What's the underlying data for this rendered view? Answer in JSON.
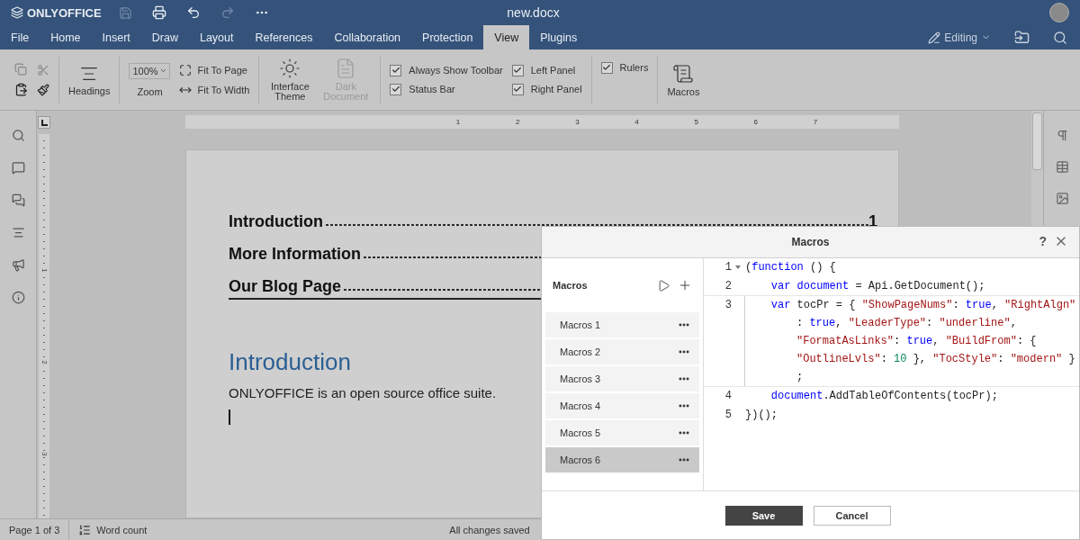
{
  "app": {
    "logo": "ONLYOFFICE",
    "file_name": "new.docx",
    "mode": "Editing"
  },
  "tabs": [
    {
      "label": "File",
      "selected": false
    },
    {
      "label": "Home",
      "selected": false
    },
    {
      "label": "Insert",
      "selected": false
    },
    {
      "label": "Draw",
      "selected": false
    },
    {
      "label": "Layout",
      "selected": false
    },
    {
      "label": "References",
      "selected": false
    },
    {
      "label": "Collaboration",
      "selected": false
    },
    {
      "label": "Protection",
      "selected": false
    },
    {
      "label": "View",
      "selected": true
    },
    {
      "label": "Plugins",
      "selected": false
    }
  ],
  "toolbar": {
    "headings": "Headings",
    "zoom_value": "100%",
    "zoom_label": "Zoom",
    "fit_page": "Fit To Page",
    "fit_width": "Fit To Width",
    "theme": "Interface Theme",
    "dark_document": {
      "label": "Dark Document",
      "disabled": true
    },
    "macros": "Macros",
    "checkboxes": [
      {
        "label": "Always Show Toolbar",
        "checked": true
      },
      {
        "label": "Status Bar",
        "checked": true
      },
      {
        "label": "Left Panel",
        "checked": true
      },
      {
        "label": "Right Panel",
        "checked": true
      },
      {
        "label": "Rulers",
        "checked": true
      }
    ]
  },
  "ruler": {
    "marks": [
      "1",
      "2",
      "3",
      "4",
      "5",
      "6",
      "7"
    ],
    "vertical_marks": [
      "1",
      "2",
      "3"
    ]
  },
  "document": {
    "toc": [
      {
        "title": "Introduction",
        "page": "1"
      },
      {
        "title": "More Information"
      },
      {
        "title": "Our Blog Page"
      }
    ],
    "heading": "Introduction",
    "body": "ONLYOFFICE is an open source office suite."
  },
  "status_bar": {
    "page": "Page 1 of 3",
    "word_count": "Word count",
    "save_status": "All changes saved"
  },
  "dialog": {
    "title": "Macros",
    "help": "?",
    "list_title": "Macros",
    "macros": [
      {
        "name": "Macros 1",
        "selected": false
      },
      {
        "name": "Macros 2",
        "selected": false
      },
      {
        "name": "Macros 3",
        "selected": false
      },
      {
        "name": "Macros 4",
        "selected": false
      },
      {
        "name": "Macros 5",
        "selected": false
      },
      {
        "name": "Macros 6",
        "selected": true
      }
    ],
    "code": [
      {
        "number": "1",
        "foldable": true,
        "active": false,
        "rows": [
          {
            "tokens": [
              {
                "kind": "plain",
                "text": "("
              },
              {
                "kind": "keyword",
                "text": "function"
              },
              {
                "kind": "plain",
                "text": " () {"
              }
            ]
          }
        ]
      },
      {
        "number": "2",
        "foldable": false,
        "active": false,
        "rows": [
          {
            "indented": true,
            "tokens": [
              {
                "kind": "keyword",
                "text": "var document"
              },
              {
                "kind": "plain",
                "text": " = Api.GetDocument();"
              }
            ]
          }
        ]
      },
      {
        "number": "3",
        "foldable": false,
        "active": true,
        "rows": [
          {
            "indented": true,
            "tokens": [
              {
                "kind": "keyword",
                "text": "var"
              },
              {
                "kind": "plain",
                "text": " tocPr = { "
              },
              {
                "kind": "string",
                "text": "\"ShowPageNums\""
              },
              {
                "kind": "plain",
                "text": ": "
              },
              {
                "kind": "keyword",
                "text": "true"
              },
              {
                "kind": "plain",
                "text": ", "
              },
              {
                "kind": "string",
                "text": "\"RightAlgn\""
              }
            ]
          },
          {
            "tokens": [
              {
                "kind": "plain",
                "text": ": "
              },
              {
                "kind": "keyword",
                "text": "true"
              },
              {
                "kind": "plain",
                "text": ", "
              },
              {
                "kind": "string",
                "text": "\"LeaderType\""
              },
              {
                "kind": "plain",
                "text": ": "
              },
              {
                "kind": "string",
                "text": "\"underline\""
              },
              {
                "kind": "plain",
                "text": ","
              }
            ]
          },
          {
            "tokens": [
              {
                "kind": "string",
                "text": "\"FormatAsLinks\""
              },
              {
                "kind": "plain",
                "text": ": "
              },
              {
                "kind": "keyword",
                "text": "true"
              },
              {
                "kind": "plain",
                "text": ", "
              },
              {
                "kind": "string",
                "text": "\"BuildFrom\""
              },
              {
                "kind": "plain",
                "text": ": {"
              }
            ]
          },
          {
            "tokens": [
              {
                "kind": "string",
                "text": "\"OutlineLvls\""
              },
              {
                "kind": "plain",
                "text": ": "
              },
              {
                "kind": "number",
                "text": "10"
              },
              {
                "kind": "plain",
                "text": " }, "
              },
              {
                "kind": "string",
                "text": "\"TocStyle\""
              },
              {
                "kind": "plain",
                "text": ": "
              },
              {
                "kind": "string",
                "text": "\"modern\""
              },
              {
                "kind": "plain",
                "text": " }"
              }
            ]
          },
          {
            "tokens": [
              {
                "kind": "plain",
                "text": ";"
              }
            ]
          }
        ]
      },
      {
        "number": "4",
        "foldable": false,
        "active": false,
        "rows": [
          {
            "indented": true,
            "tokens": [
              {
                "kind": "keyword",
                "text": "document"
              },
              {
                "kind": "plain",
                "text": ".AddTableOfContents(tocPr);"
              }
            ]
          }
        ]
      },
      {
        "number": "5",
        "foldable": false,
        "active": false,
        "rows": [
          {
            "tokens": [
              {
                "kind": "plain",
                "text": "})();"
              }
            ]
          }
        ]
      }
    ],
    "buttons": {
      "save": "Save",
      "cancel": "Cancel"
    }
  }
}
